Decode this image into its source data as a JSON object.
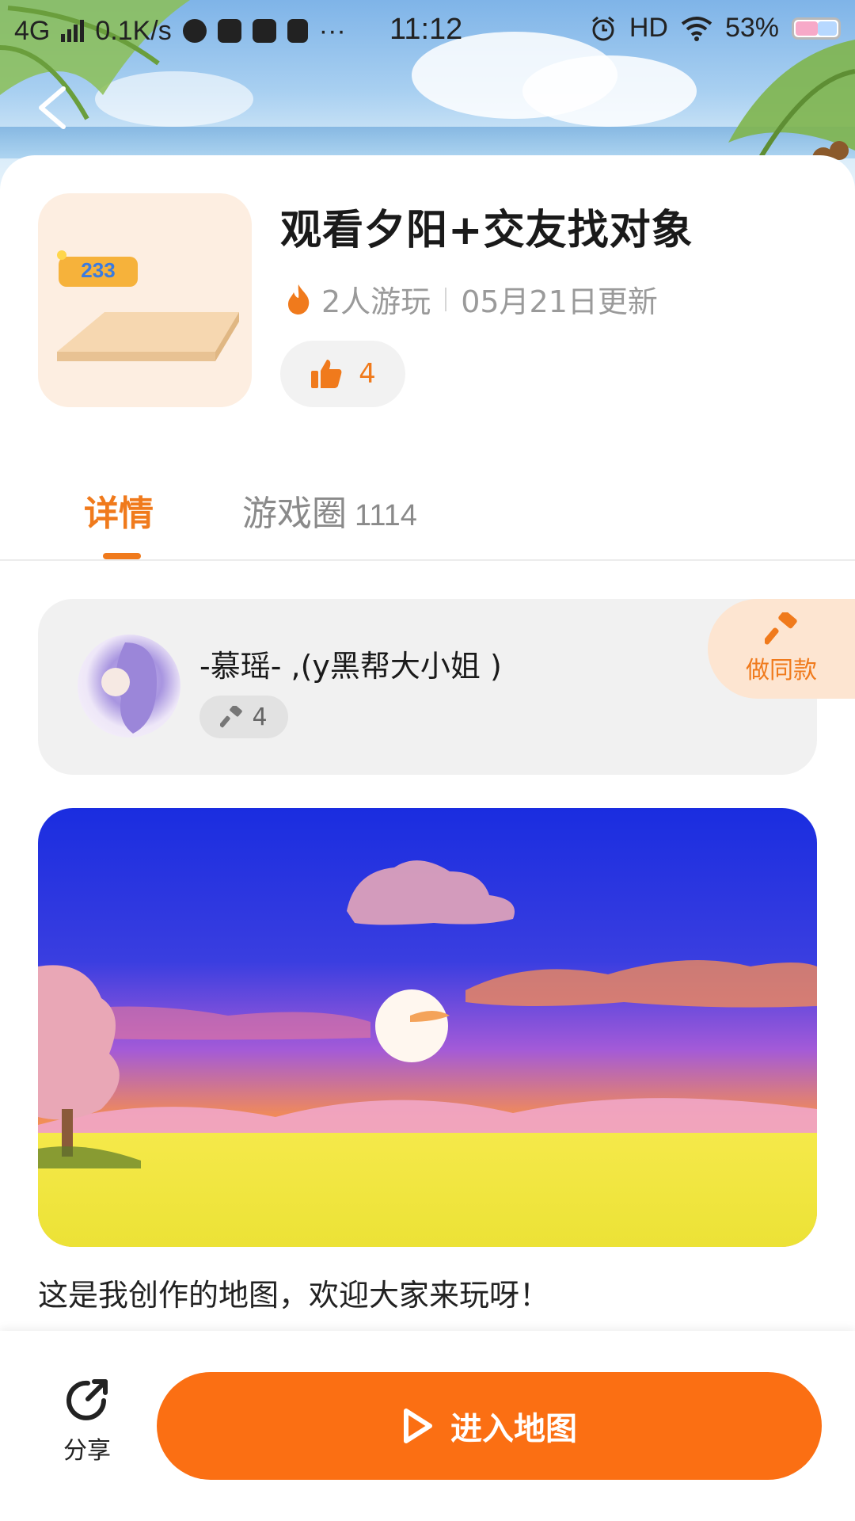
{
  "status_bar": {
    "network": "4G",
    "speed": "0.1K/s",
    "time": "11:12",
    "hd": "HD",
    "battery": "53%"
  },
  "game": {
    "title": "观看夕阳+交友找对象",
    "players": "2人游玩",
    "updated": "05月21日更新",
    "likes": "4",
    "logo_text": "233"
  },
  "tabs": [
    {
      "label": "详情",
      "active": true
    },
    {
      "label": "游戏圈",
      "count": "1114"
    }
  ],
  "author": {
    "name": "-慕瑶- ,(y黑帮大小姐 )",
    "creations": "4",
    "make_same_label": "做同款"
  },
  "description": "这是我创作的地图，欢迎大家来玩呀！",
  "bottom_bar": {
    "share_label": "分享",
    "enter_label": "进入地图"
  },
  "colors": {
    "accent": "#f07a1c",
    "button": "#fb6f13"
  }
}
